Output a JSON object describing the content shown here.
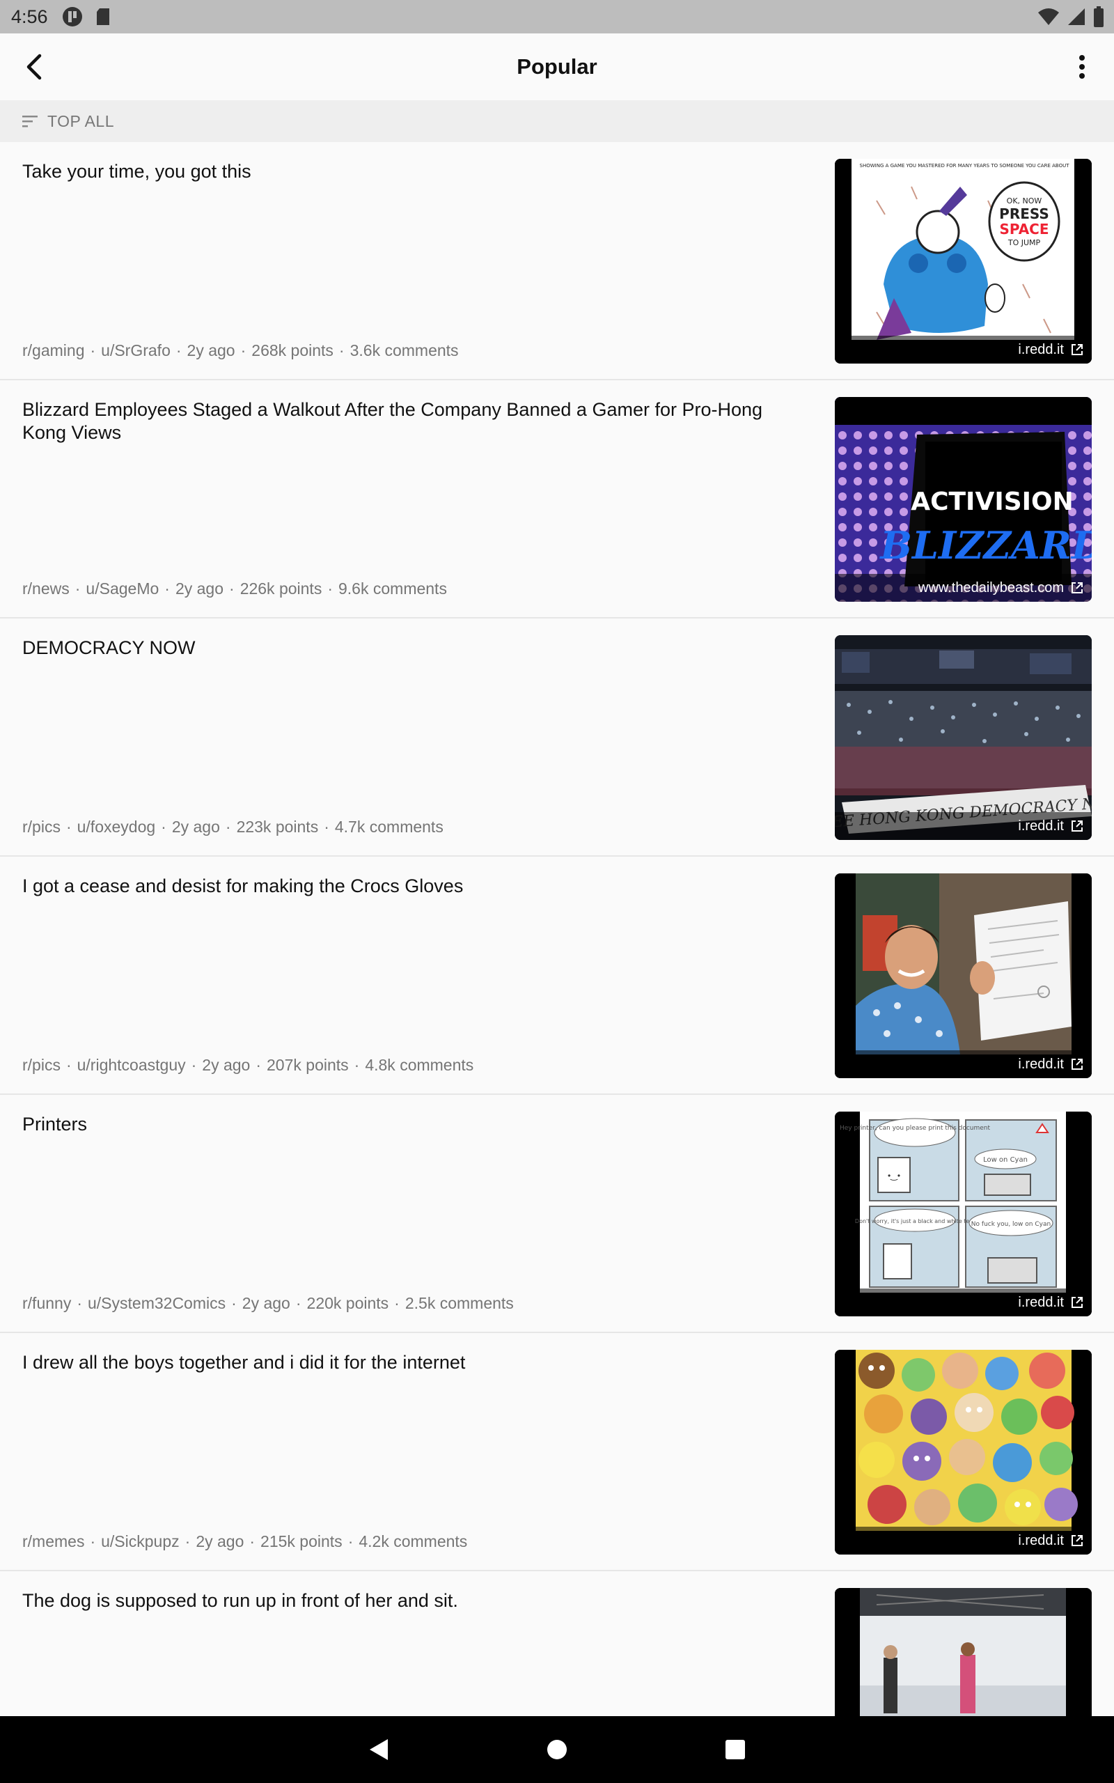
{
  "status_bar": {
    "time": "4:56"
  },
  "app_bar": {
    "title": "Popular"
  },
  "sort": {
    "label": "TOP ALL"
  },
  "posts": [
    {
      "title": "Take your time, you got this",
      "subreddit": "r/gaming",
      "author": "u/SrGrafo",
      "age": "2y ago",
      "points": "268k points",
      "comments": "3.6k comments",
      "domain": "i.redd.it"
    },
    {
      "title": "Blizzard Employees Staged a Walkout After the Company Banned a Gamer for Pro-Hong Kong Views",
      "subreddit": "r/news",
      "author": "u/SageMo",
      "age": "2y ago",
      "points": "226k points",
      "comments": "9.6k comments",
      "domain": "www.thedailybeast.com"
    },
    {
      "title": "DEMOCRACY NOW",
      "subreddit": "r/pics",
      "author": "u/foxeydog",
      "age": "2y ago",
      "points": "223k points",
      "comments": "4.7k comments",
      "domain": "i.redd.it"
    },
    {
      "title": "I got a cease and desist for making the Crocs Gloves",
      "subreddit": "r/pics",
      "author": "u/rightcoastguy",
      "age": "2y ago",
      "points": "207k points",
      "comments": "4.8k comments",
      "domain": "i.redd.it"
    },
    {
      "title": "Printers",
      "subreddit": "r/funny",
      "author": "u/System32Comics",
      "age": "2y ago",
      "points": "220k points",
      "comments": "2.5k comments",
      "domain": "i.redd.it"
    },
    {
      "title": "I drew all the boys together and i did it for the internet",
      "subreddit": "r/memes",
      "author": "u/Sickpupz",
      "age": "2y ago",
      "points": "215k points",
      "comments": "4.2k comments",
      "domain": "i.redd.it"
    },
    {
      "title": "The dog is supposed to run up in front of her and sit.",
      "subreddit": "",
      "author": "",
      "age": "",
      "points": "",
      "comments": "",
      "domain": ""
    }
  ],
  "thumbnail_text": {
    "comic_caption": "SHOWING A GAME YOU MASTERED FOR MANY YEARS TO SOMEONE YOU CARE ABOUT",
    "comic_bubble": "OK, NOW PRESS SPACE TO JUMP",
    "logo_top": "ACTIVISION",
    "logo_bottom": "BLIZZARD",
    "banner": "FREE HONG KONG DEMOCRACY NOW",
    "printer_1": "Hey printer, can you please print this document",
    "printer_2": "Low on Cyan",
    "printer_3": "Don't worry, it's just a black and white text",
    "printer_4": "No fuck you, low on Cyan"
  },
  "colors": {
    "status_bar": "#bdbdbd",
    "background": "#fafafa",
    "sort_bar": "#eeeeee",
    "meta_text": "#757575"
  }
}
